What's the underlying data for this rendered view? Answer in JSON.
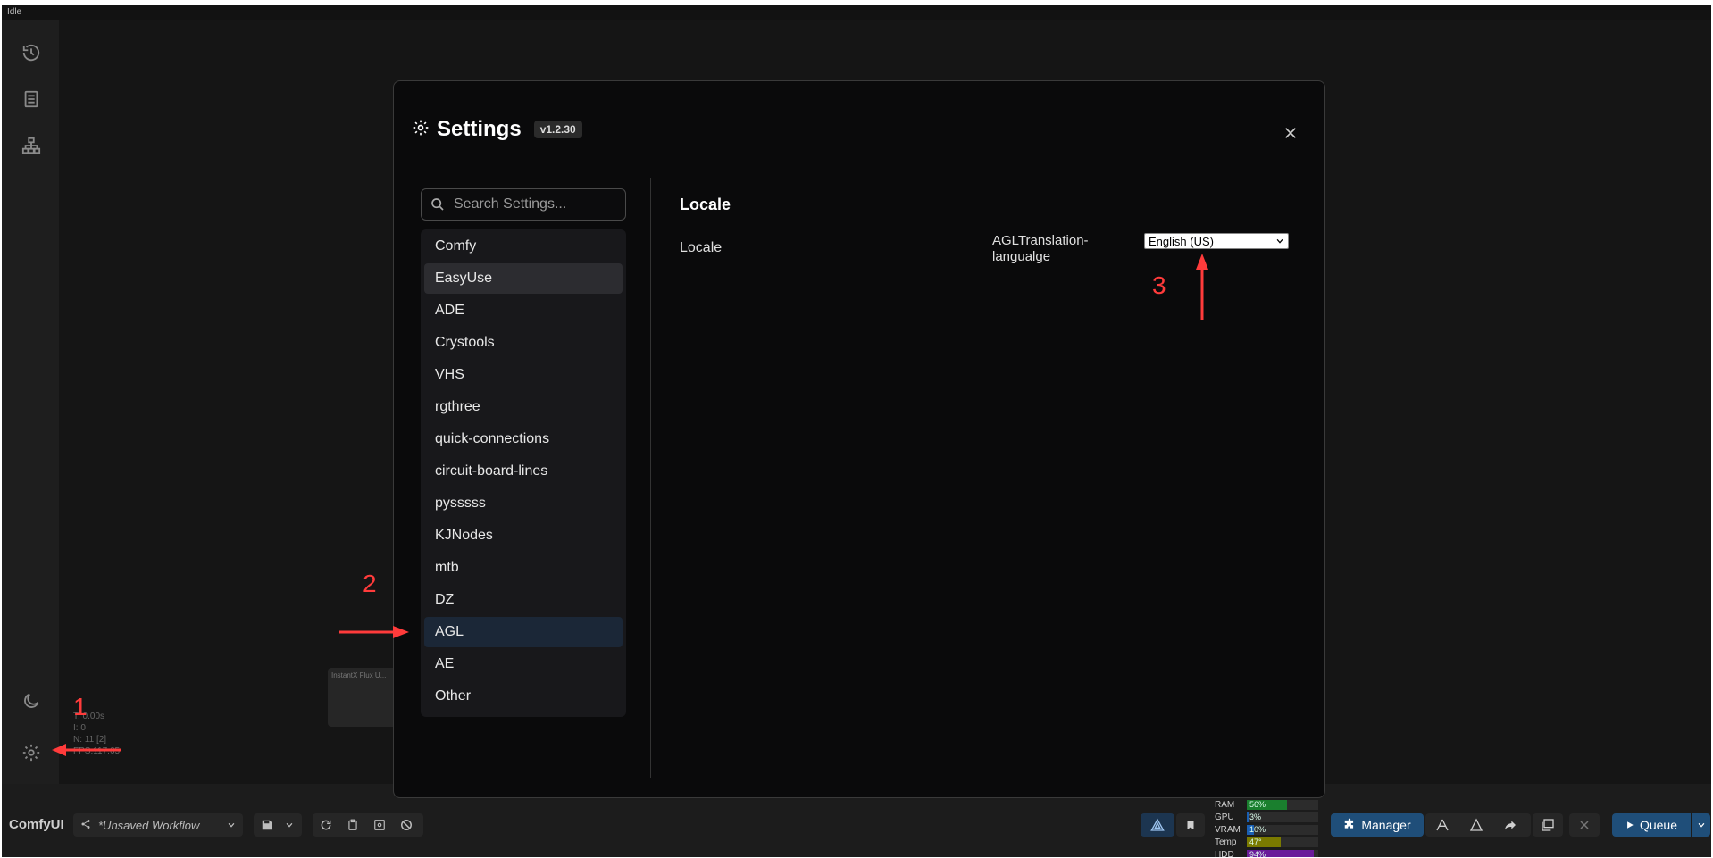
{
  "window": {
    "status": "Idle"
  },
  "sidebar": {
    "icons": [
      "history-icon",
      "document-icon",
      "node-tree-icon",
      "moon-icon",
      "gear-icon"
    ]
  },
  "canvas": {
    "stats": [
      "T: 0.00s",
      "I: 0",
      "N: 11 [2]",
      "FPS:117.65"
    ],
    "node_title": "InstantX Flux U..."
  },
  "bottom": {
    "brand": "ComfyUI",
    "workflow": "*Unsaved Workflow",
    "monitor": [
      {
        "label": "RAM",
        "value": "56%",
        "percent": 56,
        "color": "#1a7f2e"
      },
      {
        "label": "GPU",
        "value": "3%",
        "percent": 3,
        "color": "#1a5fb4"
      },
      {
        "label": "VRAM",
        "value": "10%",
        "percent": 10,
        "color": "#1a5fb4"
      },
      {
        "label": "Temp",
        "value": "47°",
        "percent": 47,
        "color": "#7a7a00"
      },
      {
        "label": "HDD",
        "value": "94%",
        "percent": 94,
        "color": "#6a1b9a"
      }
    ],
    "manager_label": "Manager",
    "queue_label": "Queue"
  },
  "settings": {
    "title": "Settings",
    "version": "v1.2.30",
    "search_placeholder": "Search Settings...",
    "categories": [
      "Comfy",
      "EasyUse",
      "ADE",
      "Crystools",
      "VHS",
      "rgthree",
      "quick-connections",
      "circuit-board-lines",
      "pysssss",
      "KJNodes",
      "mtb",
      "DZ",
      "AGL",
      "AE",
      "Other"
    ],
    "panel_title": "Locale",
    "row_label": "Locale",
    "setting_name": "AGLTranslation-langualge",
    "selected_language": "English (US)"
  },
  "annotations": [
    "1",
    "2",
    "3"
  ]
}
